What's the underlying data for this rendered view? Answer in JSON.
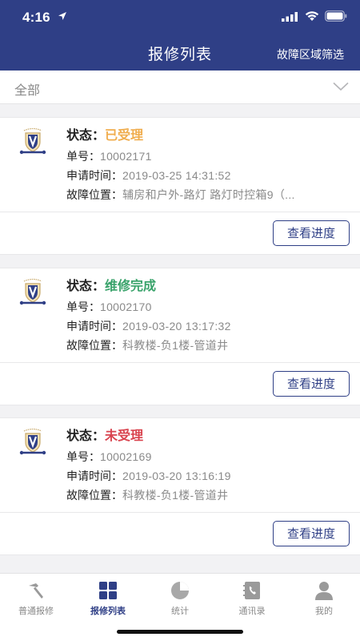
{
  "status_bar": {
    "time": "4:16"
  },
  "nav": {
    "title": "报修列表",
    "right_action": "故障区域筛选"
  },
  "filter": {
    "selected": "全部"
  },
  "labels": {
    "status": "状态：",
    "number": "单号：",
    "apply_time": "申请时间：",
    "location": "故障位置：",
    "progress_button": "查看进度"
  },
  "colors": {
    "primary": "#2f3f86",
    "status_accepted": "#f0ad4e",
    "status_done": "#3aa36b",
    "status_pending": "#d9434e"
  },
  "repairs": [
    {
      "status": "已受理",
      "number": "10002171",
      "time": "2019-03-25 14:31:52",
      "location": "辅房和户外-路灯 路灯时控箱9（..."
    },
    {
      "status": "维修完成",
      "number": "10002170",
      "time": "2019-03-20 13:17:32",
      "location": "科教楼-负1楼-管道井"
    },
    {
      "status": "未受理",
      "number": "10002169",
      "time": "2019-03-20 13:16:19",
      "location": "科教楼-负1楼-管道井"
    }
  ],
  "tabs": [
    {
      "label": "普通报修",
      "icon": "hammer-icon"
    },
    {
      "label": "报修列表",
      "icon": "grid-icon"
    },
    {
      "label": "统计",
      "icon": "pie-chart-icon"
    },
    {
      "label": "通讯录",
      "icon": "phone-book-icon"
    },
    {
      "label": "我的",
      "icon": "user-icon"
    }
  ]
}
